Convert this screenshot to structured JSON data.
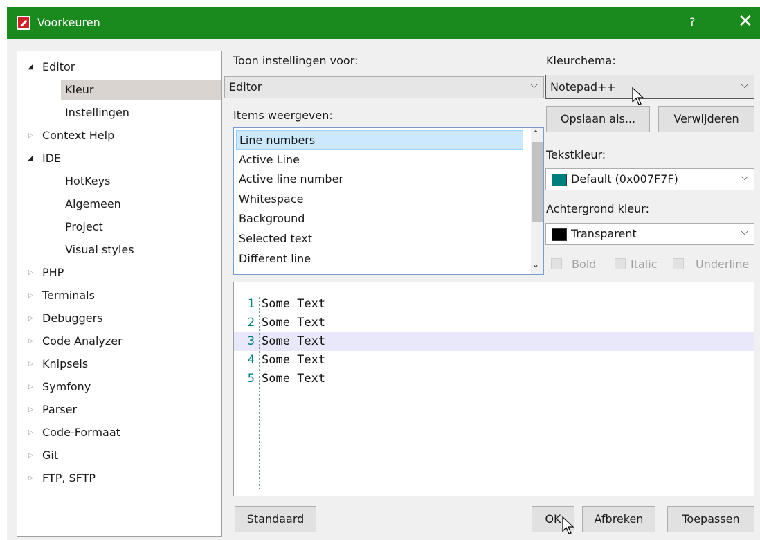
{
  "window": {
    "title": "Voorkeuren",
    "help": "?",
    "close": "✕"
  },
  "tree": {
    "items": [
      {
        "label": "Editor",
        "state": "expanded"
      },
      {
        "label": "Kleur",
        "state": "leaf",
        "selected": true
      },
      {
        "label": "Instellingen",
        "state": "leaf"
      },
      {
        "label": "Context Help",
        "state": "collapsed"
      },
      {
        "label": "IDE",
        "state": "expanded"
      },
      {
        "label": "HotKeys",
        "state": "leaf"
      },
      {
        "label": "Algemeen",
        "state": "leaf"
      },
      {
        "label": "Project",
        "state": "leaf"
      },
      {
        "label": "Visual styles",
        "state": "leaf"
      },
      {
        "label": "PHP",
        "state": "collapsed"
      },
      {
        "label": "Terminals",
        "state": "collapsed"
      },
      {
        "label": "Debuggers",
        "state": "collapsed"
      },
      {
        "label": "Code Analyzer",
        "state": "collapsed"
      },
      {
        "label": "Knipsels",
        "state": "collapsed"
      },
      {
        "label": "Symfony",
        "state": "collapsed"
      },
      {
        "label": "Parser",
        "state": "collapsed"
      },
      {
        "label": "Code-Formaat",
        "state": "collapsed"
      },
      {
        "label": "Git",
        "state": "collapsed"
      },
      {
        "label": "FTP, SFTP",
        "state": "collapsed"
      }
    ]
  },
  "settings": {
    "show_for_label": "Toon instellingen voor:",
    "show_for_value": "Editor",
    "items_label": "Items weergeven:",
    "items": [
      "Line numbers",
      "Active Line",
      "Active line number",
      "Whitespace",
      "Background",
      "Selected text",
      "Different line"
    ]
  },
  "scheme": {
    "label": "Kleurchema:",
    "value": "Notepad++",
    "save_as": "Opslaan als...",
    "delete": "Verwijderen",
    "text_color_label": "Tekstkleur:",
    "text_color_value": "Default (0x007F7F)",
    "text_color_swatch": "#007f7f",
    "bg_color_label": "Achtergrond kleur:",
    "bg_color_value": "Transparent",
    "bg_color_swatch": "#000000",
    "bold": "Bold",
    "italic": "Italic",
    "underline": "Underline"
  },
  "preview": {
    "lines": [
      {
        "num": "1",
        "text": "Some Text"
      },
      {
        "num": "2",
        "text": "Some Text"
      },
      {
        "num": "3",
        "text": "Some Text"
      },
      {
        "num": "4",
        "text": "Some Text"
      },
      {
        "num": "5",
        "text": "Some Text"
      }
    ]
  },
  "footer": {
    "default": "Standaard",
    "ok": "OK",
    "cancel": "Afbreken",
    "apply": "Toepassen"
  }
}
